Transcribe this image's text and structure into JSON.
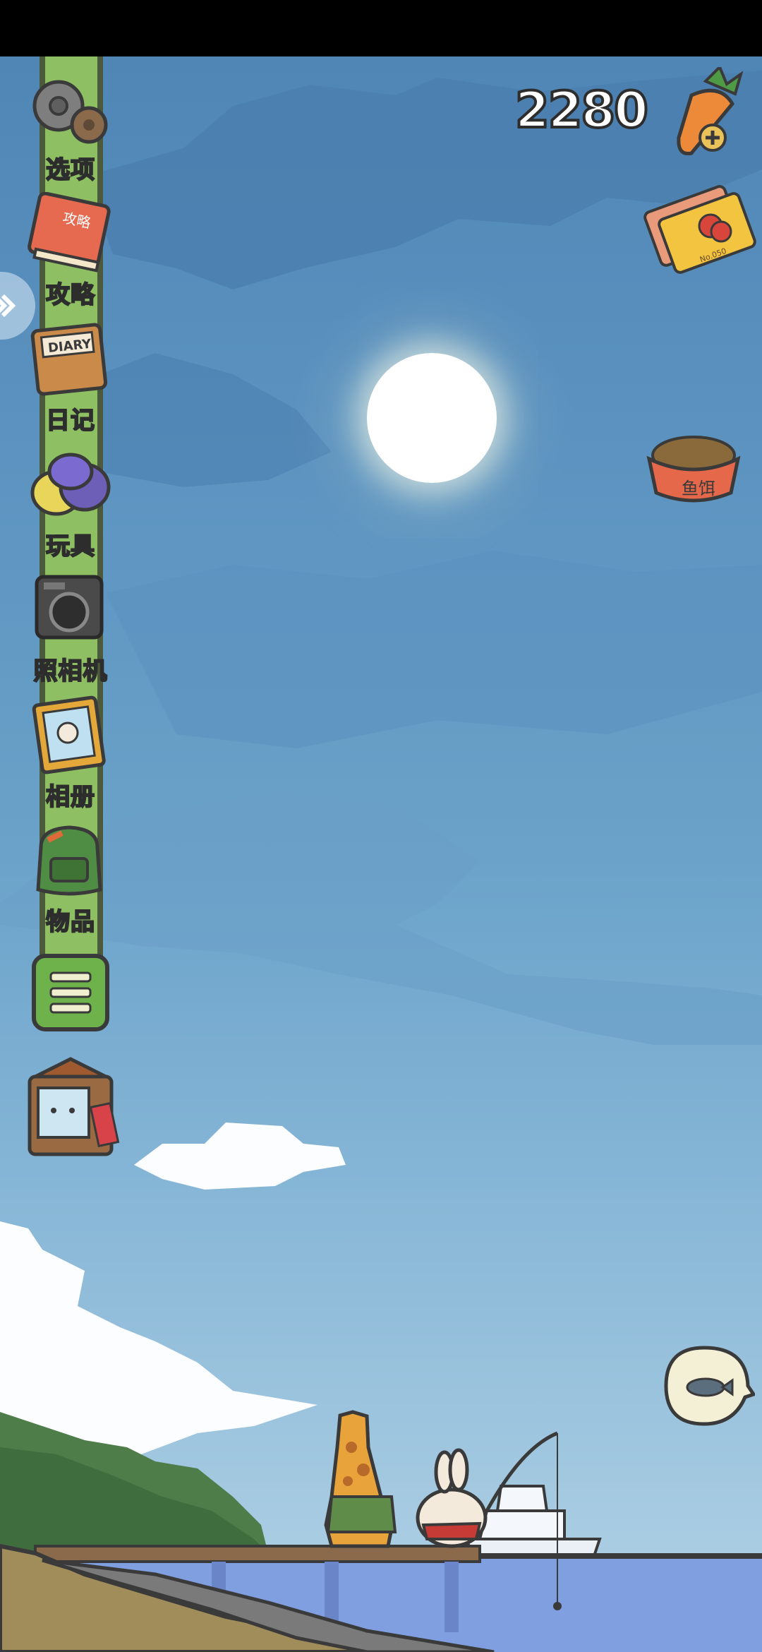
{
  "hud": {
    "carrot_count": "2280"
  },
  "sidebar": {
    "items": [
      {
        "label": "选项",
        "icon": "gear-icon"
      },
      {
        "label": "攻略",
        "icon": "guide-book-icon"
      },
      {
        "label": "日记",
        "icon": "diary-icon"
      },
      {
        "label": "玩具",
        "icon": "toys-icon"
      },
      {
        "label": "照相机",
        "icon": "camera-icon"
      },
      {
        "label": "相册",
        "icon": "photo-album-icon"
      },
      {
        "label": "物品",
        "icon": "backpack-icon"
      }
    ],
    "collapse_icon": "collapse-menu-icon"
  },
  "icons": {
    "diary_cover_text": "DIARY",
    "guide_cover_text": "攻略",
    "food_bowl_text": "鱼饵",
    "ticket_text": "No.050"
  },
  "colors": {
    "pole": "#8ec063",
    "sky_top": "#4f86b6",
    "sky_bottom": "#b3d3e6",
    "water": "#7f9fe0"
  }
}
